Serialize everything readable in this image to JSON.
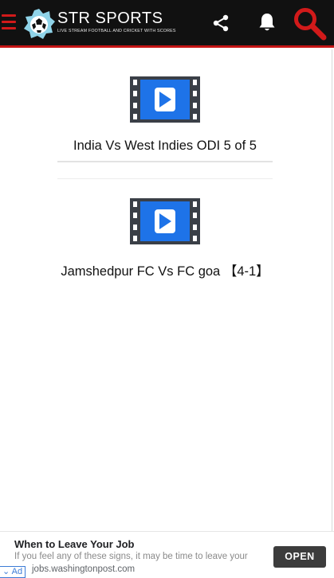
{
  "header": {
    "brand_title": "STR SPORTS",
    "brand_subtitle": "LIVE STREAM FOOTBALL AND CRICKET WITH SCORES"
  },
  "videos": [
    {
      "title": "India Vs West Indies ODI 5 of 5",
      "icon": "video-play-icon"
    },
    {
      "title": "Jamshedpur FC Vs  FC goa 【4-1】",
      "icon": "video-play-icon"
    }
  ],
  "ad": {
    "title": "When to Leave Your Job",
    "text": "If you feel any of these signs, it may be time to leave your",
    "url": "jobs.washingtonpost.com",
    "badge": "⌄ Ad",
    "button": "OPEN"
  },
  "colors": {
    "header_bg": "#111111",
    "accent_red": "#c41414",
    "play_blue": "#1e73e8"
  }
}
